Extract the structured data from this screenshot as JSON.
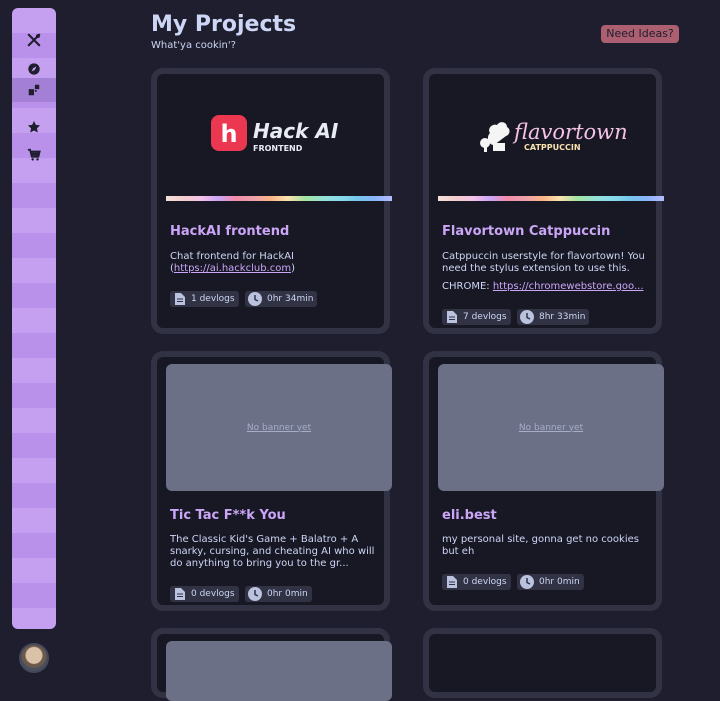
{
  "header": {
    "title": "My Projects",
    "subtitle": "What'ya cookin'?",
    "ideas_button": "Need Ideas?"
  },
  "sidebar": {
    "items": [
      {
        "icon": "utensils-icon",
        "active": false
      },
      {
        "icon": "compass-icon",
        "active": false
      },
      {
        "icon": "projects-icon",
        "active": true
      },
      {
        "icon": "star-icon",
        "active": false
      },
      {
        "icon": "cart-icon",
        "active": false
      }
    ]
  },
  "projects": [
    {
      "title": "HackAI frontend",
      "banner_text": "Hack AI",
      "banner_subtext": "FRONTEND",
      "banner_logo_letter": "h",
      "desc": "Chat frontend for HackAI (",
      "desc_link": "https://ai.hackclub.com",
      "desc_end": ")",
      "devlogs": "1 devlogs",
      "time": "0hr 34min"
    },
    {
      "title": "Flavortown Catppuccin",
      "banner_text": "flavortown",
      "banner_subtext": "CATPPUCCIN",
      "desc": "Catppuccin userstyle for flavortown! You need the stylus extension to use this.",
      "desc2_prefix": "CHROME: ",
      "desc2_link": "https://chromewebstore.goo...",
      "devlogs": "7 devlogs",
      "time": "8hr 33min"
    },
    {
      "title": "Tic Tac F**k You",
      "banner_placeholder": "No banner yet",
      "desc": "The Classic Kid's Game + Balatro + A snarky, cursing, and cheating AI who will do anything to bring you to the gr...",
      "devlogs": "0 devlogs",
      "time": "0hr 0min"
    },
    {
      "title": "eli.best",
      "banner_placeholder": "No banner yet",
      "desc": "my personal site, gonna get no cookies but eh",
      "devlogs": "0 devlogs",
      "time": "0hr 0min"
    }
  ],
  "colors": {
    "background": "#1e1e2e",
    "card": "#181825",
    "card_border": "#313244",
    "accent": "#cba6f7",
    "sidebar": "#c6a0f0",
    "ideas_button": "#ab5f70"
  }
}
